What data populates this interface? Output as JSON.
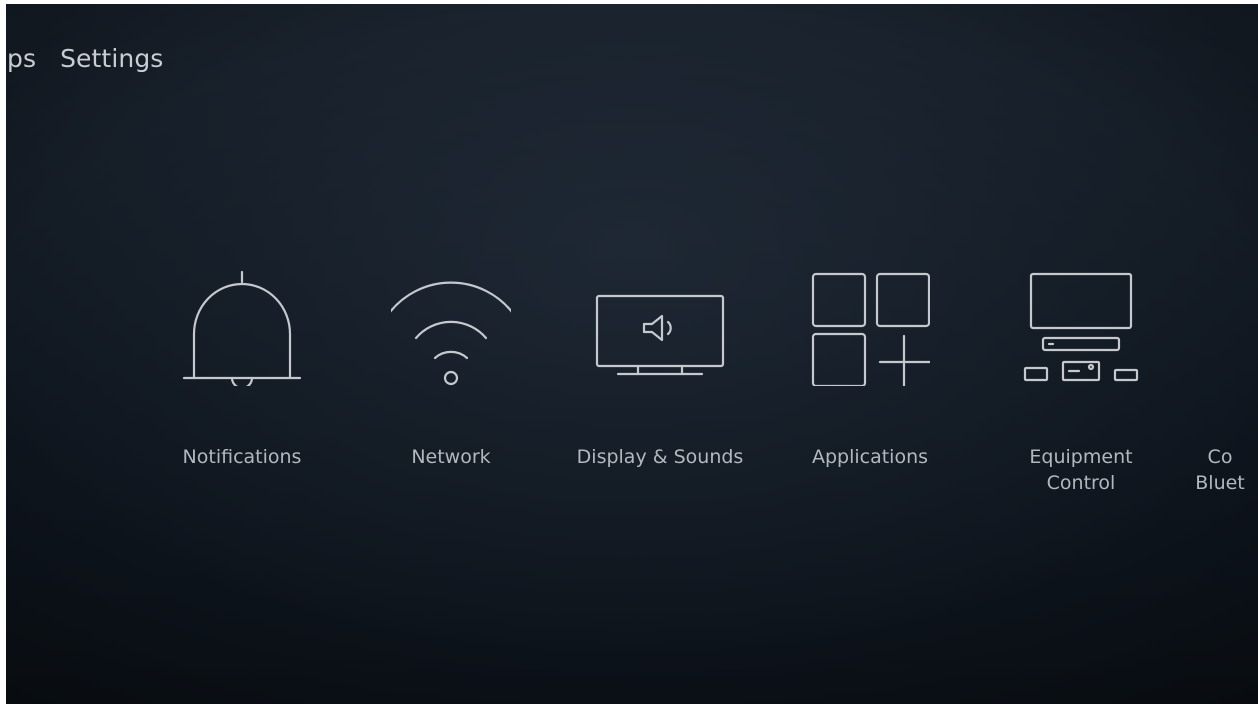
{
  "nav": {
    "items": [
      {
        "label": "pps"
      },
      {
        "label": "Settings"
      }
    ]
  },
  "settings": {
    "items": [
      {
        "label": "Notifications",
        "icon": "bell-icon"
      },
      {
        "label": "Network",
        "icon": "wifi-icon"
      },
      {
        "label": "Display & Sounds",
        "icon": "tv-speaker-icon"
      },
      {
        "label": "Applications",
        "icon": "apps-grid-icon"
      },
      {
        "label_line1": "Equipment",
        "label_line2": "Control",
        "icon": "equipment-icon"
      },
      {
        "label_line1": "Co",
        "label_line2": "Bluet",
        "icon": "controllers-bluetooth-icon"
      }
    ]
  },
  "colors": {
    "background": "#111922",
    "text_primary": "#c9cdd1",
    "text_secondary": "#b3b8bd",
    "icon_stroke": "#c5c9cd"
  }
}
